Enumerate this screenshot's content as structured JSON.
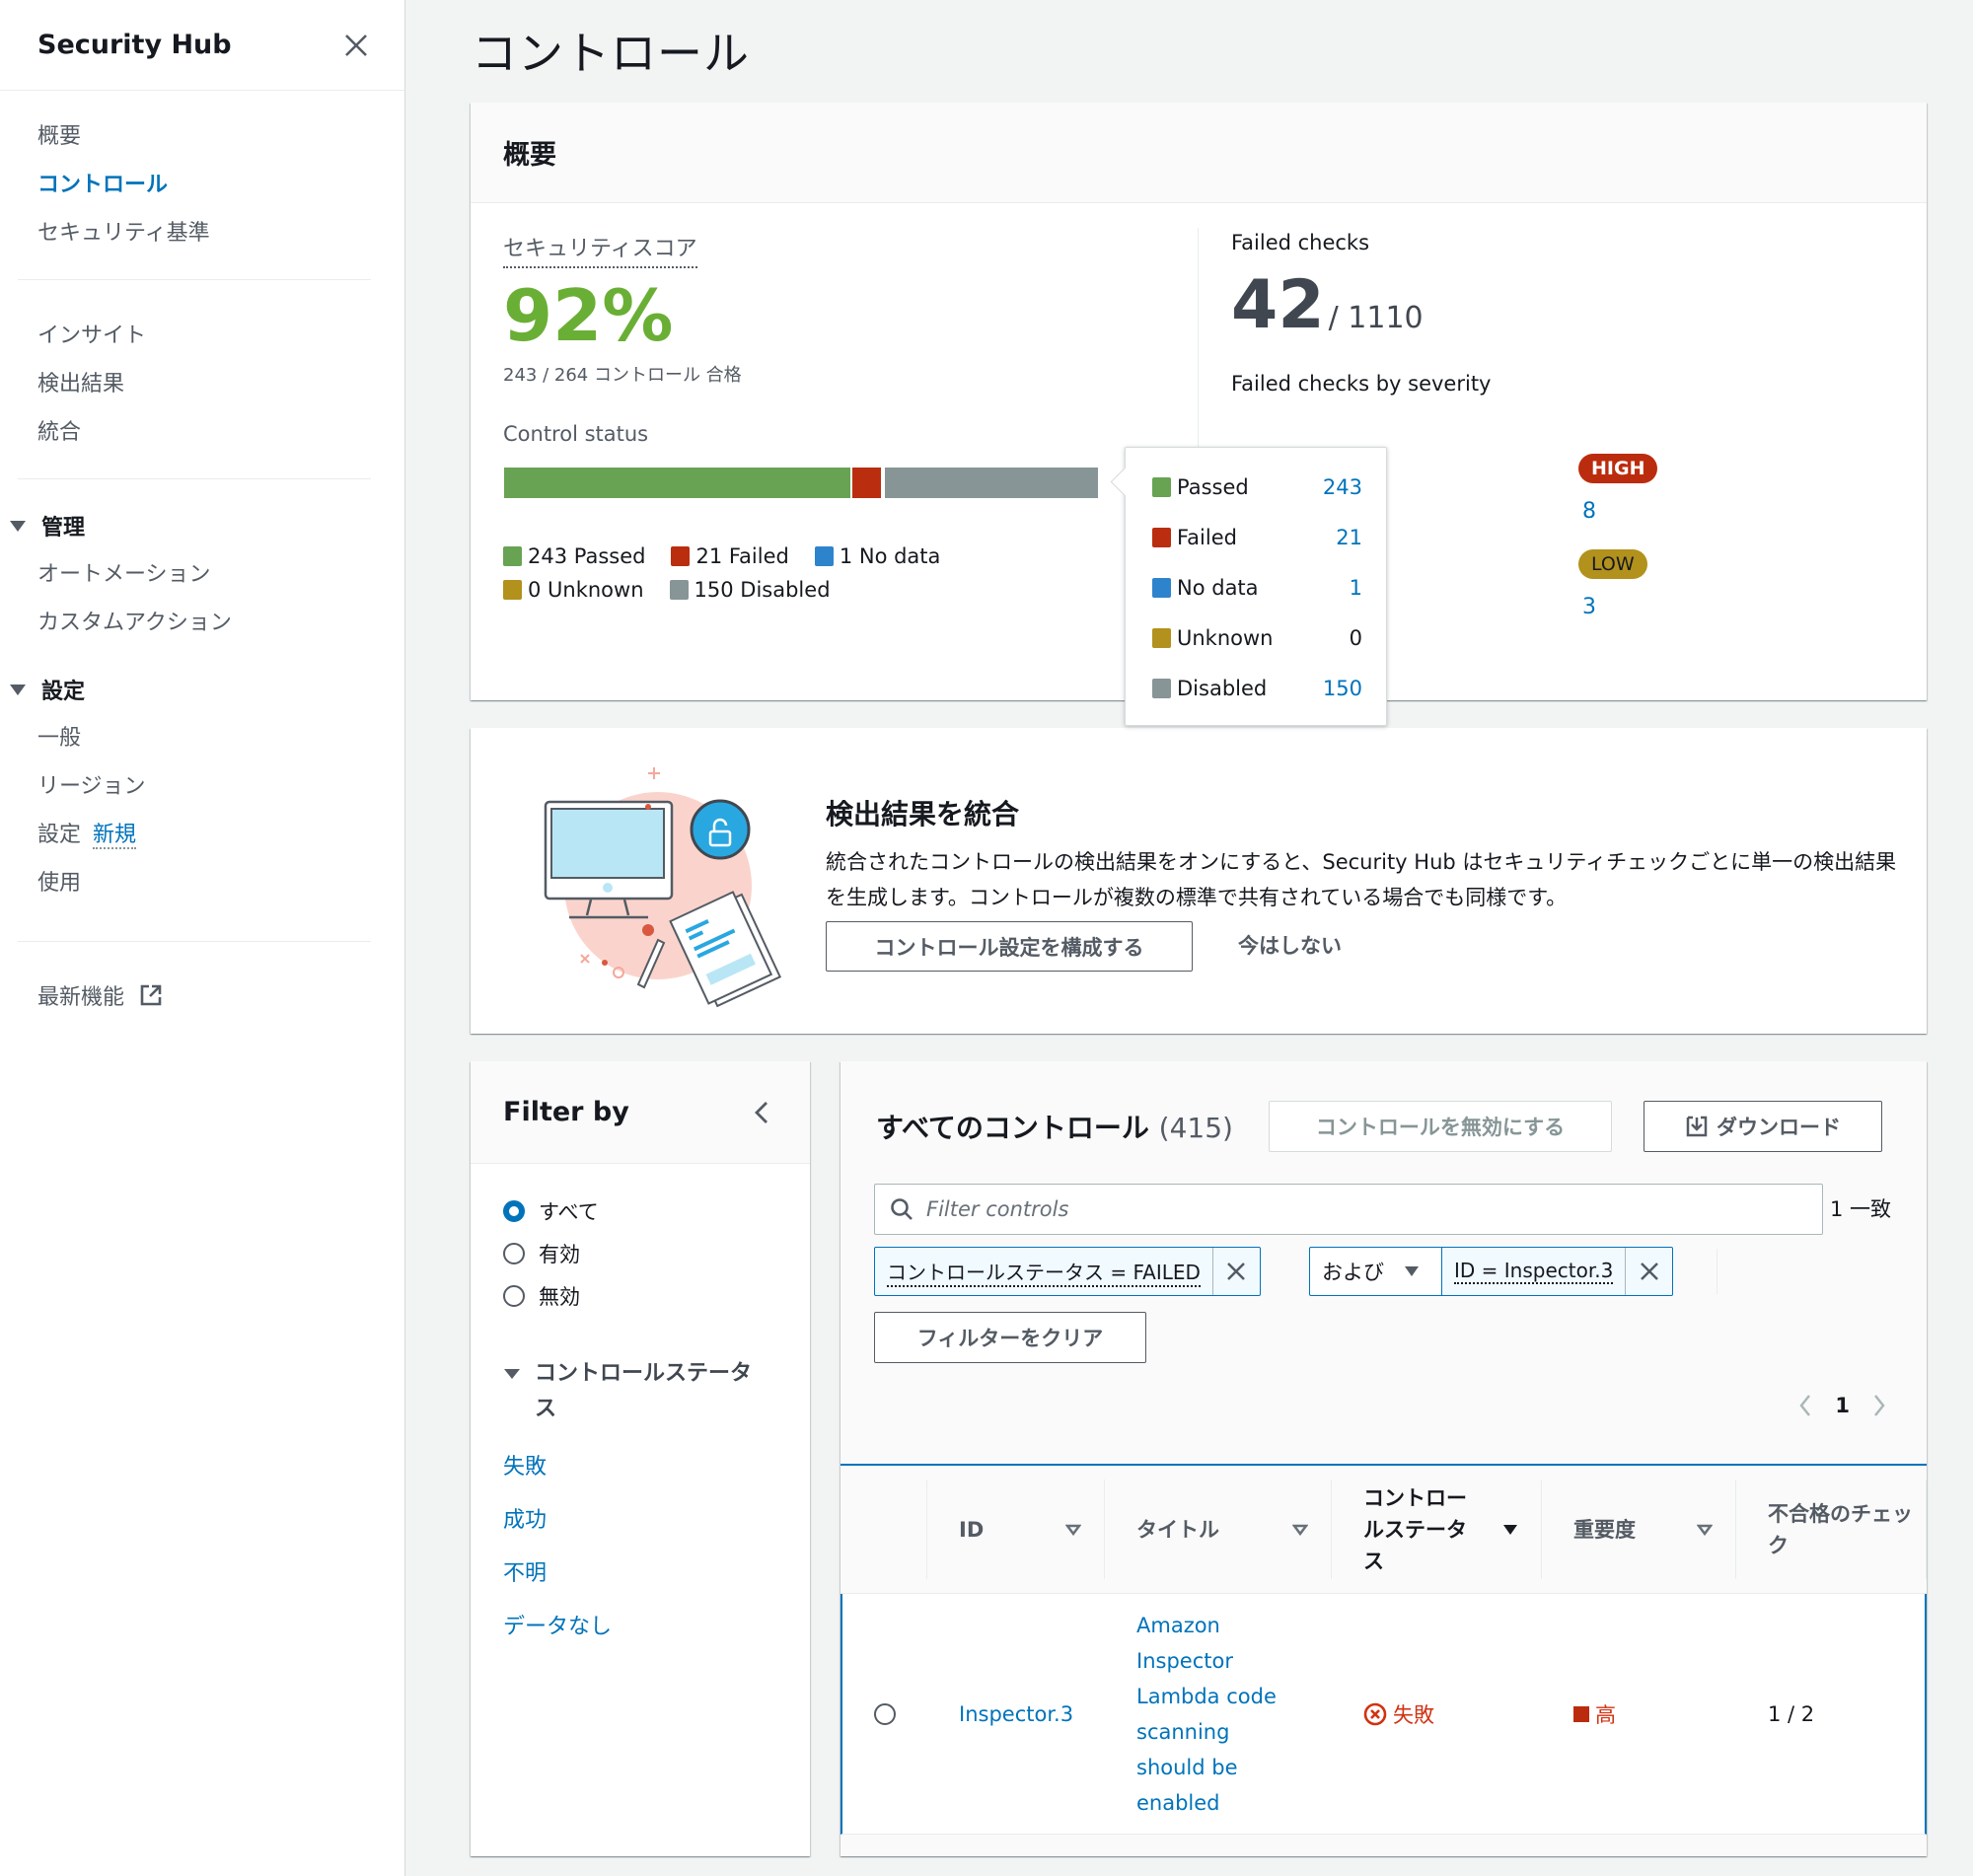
{
  "sidebar": {
    "title": "Security Hub",
    "close_icon": "close-icon",
    "group1": [
      {
        "label": "概要",
        "active": false
      },
      {
        "label": "コントロール",
        "active": true
      },
      {
        "label": "セキュリティ基準",
        "active": false
      }
    ],
    "group2": [
      {
        "label": "インサイト"
      },
      {
        "label": "検出結果"
      },
      {
        "label": "統合"
      }
    ],
    "management": {
      "label": "管理",
      "items": [
        {
          "label": "オートメーション"
        },
        {
          "label": "カスタムアクション"
        }
      ]
    },
    "settings": {
      "label": "設定",
      "items": [
        {
          "label": "一般"
        },
        {
          "label": "リージョン"
        },
        {
          "label": "設定",
          "badge": "新規"
        },
        {
          "label": "使用"
        }
      ]
    },
    "whats_new": {
      "label": "最新機能",
      "icon": "external-link-icon"
    }
  },
  "page": {
    "title": "コントロール"
  },
  "overview": {
    "header": "概要",
    "security_score": {
      "label": "セキュリティスコア",
      "value": "92%",
      "subtext": "243 / 264 コントロール 合格"
    },
    "control_status": {
      "label": "Control status",
      "segments": [
        {
          "key": "passed",
          "label": "Passed",
          "count": 243,
          "legend": "243 Passed",
          "color": "#67a353"
        },
        {
          "key": "failed",
          "label": "Failed",
          "count": 21,
          "legend": "21 Failed",
          "color": "#ba2e0f"
        },
        {
          "key": "nodata",
          "label": "No data",
          "count": 1,
          "legend": "1 No data",
          "color": "#2e84cc"
        },
        {
          "key": "unknown",
          "label": "Unknown",
          "count": 0,
          "legend": "0 Unknown",
          "color": "#b2911c"
        },
        {
          "key": "disabled",
          "label": "Disabled",
          "count": 150,
          "legend": "150 Disabled",
          "color": "#879596"
        }
      ]
    },
    "failed_checks": {
      "label": "Failed checks",
      "value": "42",
      "total": "/ 1110",
      "by_severity_label": "Failed checks by severity",
      "severities": [
        {
          "label": "HIGH",
          "count": "8",
          "color": "#bb2c0e"
        },
        {
          "label": "LOW",
          "count": "3",
          "color": "#b2911c"
        }
      ]
    }
  },
  "banner": {
    "title": "検出結果を統合",
    "text": "統合されたコントロールの検出結果をオンにすると、Security Hub はセキュリティチェックごとに単一の検出結果を生成します。コントロールが複数の標準で共有されている場合でも同様です。",
    "primary_button": "コントロール設定を構成する",
    "dismiss_link": "今はしない"
  },
  "filter_panel": {
    "title": "Filter by",
    "radios": [
      {
        "label": "すべて",
        "checked": true
      },
      {
        "label": "有効",
        "checked": false
      },
      {
        "label": "無効",
        "checked": false
      }
    ],
    "status_section": {
      "label": "コントロールステータス",
      "links": [
        "失敗",
        "成功",
        "不明",
        "データなし"
      ]
    }
  },
  "controls": {
    "title": "すべてのコントロール",
    "count": "(415)",
    "disable_button": "コントロールを無効にする",
    "download_button": "ダウンロード",
    "search": {
      "placeholder": "Filter controls",
      "value": ""
    },
    "match_text": "1 一致",
    "tokens": [
      {
        "text": "コントロールステータス = FAILED"
      },
      {
        "text": "ID = Inspector.3"
      }
    ],
    "operator": "および",
    "clear_button": "フィルターをクリア",
    "pagination": {
      "current_page": "1"
    },
    "columns": [
      {
        "label": "",
        "sortable": false
      },
      {
        "label": "ID",
        "sortable": true,
        "sorted": false
      },
      {
        "label": "タイトル",
        "sortable": true,
        "sorted": false
      },
      {
        "label": "コントロールステータス",
        "sortable": true,
        "sorted": true
      },
      {
        "label": "重要度",
        "sortable": true,
        "sorted": false
      },
      {
        "label": "不合格のチェック",
        "sortable": false
      }
    ],
    "rows": [
      {
        "selected": false,
        "id": "Inspector.3",
        "title": "Amazon Inspector Lambda code scanning should be enabled",
        "status": "失敗",
        "severity": "高",
        "failed_checks": "1 / 2"
      }
    ]
  }
}
